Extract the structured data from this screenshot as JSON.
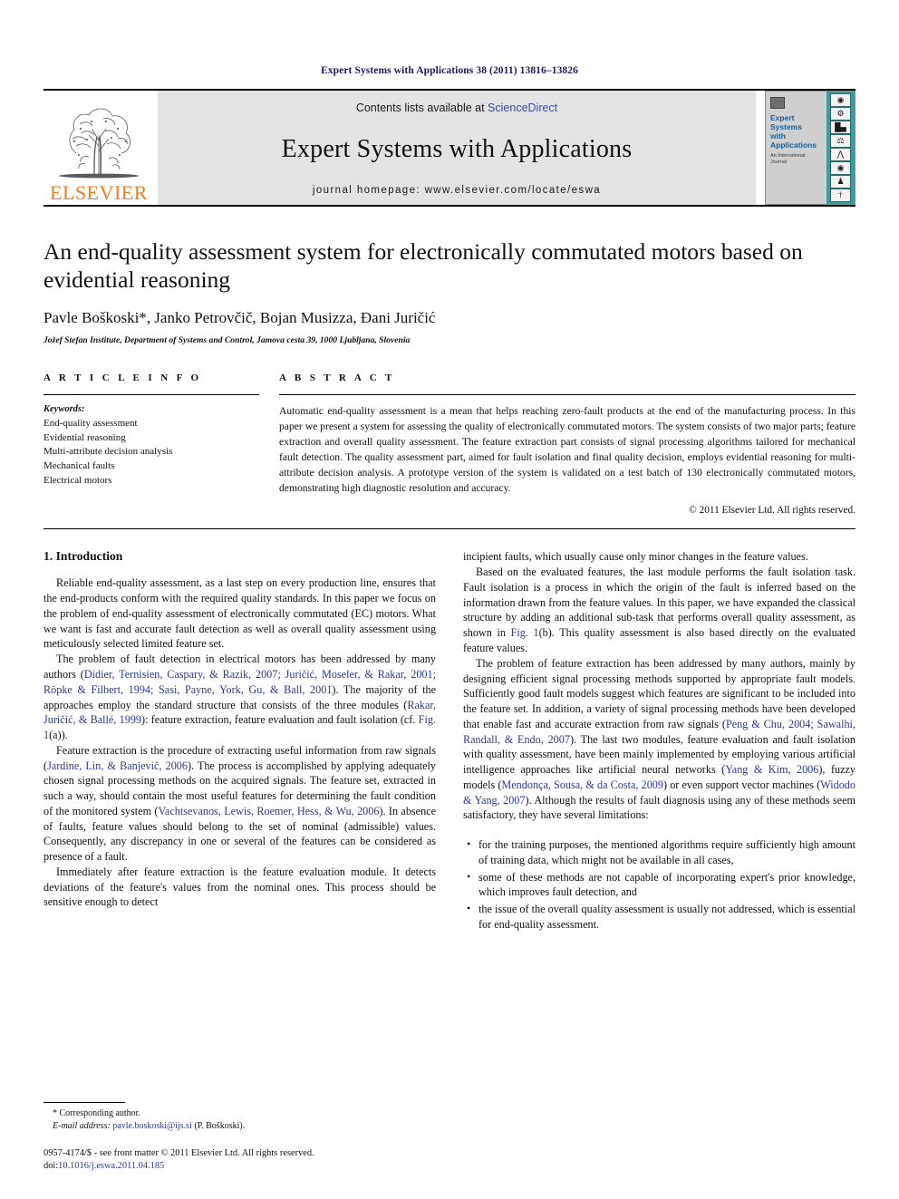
{
  "running_head": "Expert Systems with Applications 38 (2011) 13816–13826",
  "masthead": {
    "publisher_wordmark": "ELSEVIER",
    "contents_prefix": "Contents lists available at ",
    "sciencedirect": "ScienceDirect",
    "journal_title": "Expert Systems with Applications",
    "homepage": "journal homepage: www.elsevier.com/locate/eswa",
    "cover": {
      "title": "Expert\nSystems\nwith\nApplications",
      "subtitle": "An International\nJournal",
      "icons": [
        "gauge-icon",
        "gear-icon",
        "bar-chart-icon",
        "scales-icon",
        "microscope-icon",
        "eye-icon",
        "person-icon",
        "antenna-icon"
      ]
    },
    "accent_color": "#ED7C22",
    "banner_bg": "#e3e3e3",
    "link_color": "#3b4fa0"
  },
  "article": {
    "title": "An end-quality assessment system for electronically commutated motors based on evidential reasoning",
    "authors": "Pavle Boškoski*, Janko Petrovčič, Bojan Musizza, Đani Juričić",
    "affiliation": "Jožef Stefan Institute, Department of Systems and Control, Jamova cesta 39, 1000 Ljubljana, Slovenia"
  },
  "article_info": {
    "heading": "A R T I C L E    I N F O",
    "keywords_label": "Keywords:",
    "keywords": [
      "End-quality assessment",
      "Evidential reasoning",
      "Multi-attribute decision analysis",
      "Mechanical faults",
      "Electrical motors"
    ]
  },
  "abstract": {
    "heading": "A B S T R A C T",
    "text": "Automatic end-quality assessment is a mean that helps reaching zero-fault products at the end of the manufacturing process. In this paper we present a system for assessing the quality of electronically commutated motors. The system consists of two major parts; feature extraction and overall quality assessment. The feature extraction part consists of signal processing algorithms tailored for mechanical fault detection. The quality assessment part, aimed for fault isolation and final quality decision, employs evidential reasoning for multi-attribute decision analysis. A prototype version of the system is validated on a test batch of 130 electronically commutated motors, demonstrating high diagnostic resolution and accuracy.",
    "copyright": "© 2011 Elsevier Ltd. All rights reserved."
  },
  "body": {
    "section_heading": "1. Introduction",
    "left_paragraphs": [
      {
        "id": "p1",
        "segments": [
          {
            "t": "Reliable end-quality assessment, as a last step on every production line, ensures that the end-products conform with the required quality standards. In this paper we focus on the problem of end-quality assessment of electronically commutated (EC) motors. What we want is fast and accurate fault detection as well as overall quality assessment using meticulously selected limited feature set.",
            "ref": false
          }
        ]
      },
      {
        "id": "p2",
        "segments": [
          {
            "t": "The problem of fault detection in electrical motors has been addressed by many authors (",
            "ref": false
          },
          {
            "t": "Didier, Ternisien, Caspary, & Razik, 2007; Juričić, Moseler, & Rakar, 2001; Röpke & Filbert, 1994; Sasi, Payne, York, Gu, & Ball, 2001",
            "ref": true
          },
          {
            "t": "). The majority of the approaches employ the standard structure that consists of the three modules (",
            "ref": false
          },
          {
            "t": "Rakar, Juričić, & Ballé, 1999",
            "ref": true
          },
          {
            "t": "): feature extraction, feature evaluation and fault isolation (cf. ",
            "ref": false
          },
          {
            "t": "Fig. 1",
            "ref": true
          },
          {
            "t": "(a)).",
            "ref": false
          }
        ]
      },
      {
        "id": "p3",
        "segments": [
          {
            "t": "Feature extraction is the procedure of extracting useful information from raw signals (",
            "ref": false
          },
          {
            "t": "Jardine, Lin, & Banjevič, 2006",
            "ref": true
          },
          {
            "t": "). The process is accomplished by applying adequately chosen signal processing methods on the acquired signals. The feature set, extracted in such a way, should contain the most useful features for determining the fault condition of the monitored system (",
            "ref": false
          },
          {
            "t": "Vachtsevanos, Lewis, Roemer, Hess, & Wu, 2006",
            "ref": true
          },
          {
            "t": "). In absence of faults, feature values should belong to the set of nominal (admissible) values. Consequently, any discrepancy in one or several of the features can be considered as presence of a fault.",
            "ref": false
          }
        ]
      },
      {
        "id": "p4",
        "segments": [
          {
            "t": "Immediately after feature extraction is the feature evaluation module. It detects deviations of the feature's values from the nominal ones. This process should be sensitive enough to detect",
            "ref": false
          }
        ]
      }
    ],
    "right_paragraphs": [
      {
        "id": "r1",
        "continuation": true,
        "segments": [
          {
            "t": "incipient faults, which usually cause only minor changes in the feature values.",
            "ref": false
          }
        ]
      },
      {
        "id": "r2",
        "segments": [
          {
            "t": "Based on the evaluated features, the last module performs the fault isolation task. Fault isolation is a process in which the origin of the fault is inferred based on the information drawn from the feature values. In this paper, we have expanded the classical structure by adding an additional sub-task that performs overall quality assessment, as shown in ",
            "ref": false
          },
          {
            "t": "Fig. 1",
            "ref": true
          },
          {
            "t": "(b). This quality assessment is also based directly on the evaluated feature values.",
            "ref": false
          }
        ]
      },
      {
        "id": "r3",
        "segments": [
          {
            "t": "The problem of feature extraction has been addressed by many authors, mainly by designing efficient signal processing methods supported by appropriate fault models. Sufficiently good fault models suggest which features are significant to be included into the feature set. In addition, a variety of signal processing methods have been developed that enable fast and accurate extraction from raw signals (",
            "ref": false
          },
          {
            "t": "Peng & Chu, 2004; Sawalhi, Randall, & Endo, 2007",
            "ref": true
          },
          {
            "t": "). The last two modules, feature evaluation and fault isolation with quality assessment, have been mainly implemented by employing various artificial intelligence approaches like artificial neural networks (",
            "ref": false
          },
          {
            "t": "Yang & Kim, 2006",
            "ref": true
          },
          {
            "t": "), fuzzy models (",
            "ref": false
          },
          {
            "t": "Mendonça, Sousa, & da Costa, 2009",
            "ref": true
          },
          {
            "t": ") or even support vector machines (",
            "ref": false
          },
          {
            "t": "Widodo & Yang, 2007",
            "ref": true
          },
          {
            "t": "). Although the results of fault diagnosis using any of these methods seem satisfactory, they have several limitations:",
            "ref": false
          }
        ]
      }
    ],
    "limitations": [
      "for the training purposes, the mentioned algorithms require sufficiently high amount of training data, which might not be available in all cases,",
      "some of these methods are not capable of incorporating expert's prior knowledge, which improves fault detection, and",
      "the issue of the overall quality assessment is usually not addressed, which is essential for end-quality assessment."
    ]
  },
  "footnotes": {
    "corresponding": "* Corresponding author.",
    "email_label": "E-mail address:",
    "email": "pavle.boskoski@ijs.si",
    "email_suffix": " (P. Boškoski).",
    "issn_line": "0957-4174/$ - see front matter © 2011 Elsevier Ltd. All rights reserved.",
    "doi_label": "doi:",
    "doi": "10.1016/j.eswa.2011.04.185"
  }
}
